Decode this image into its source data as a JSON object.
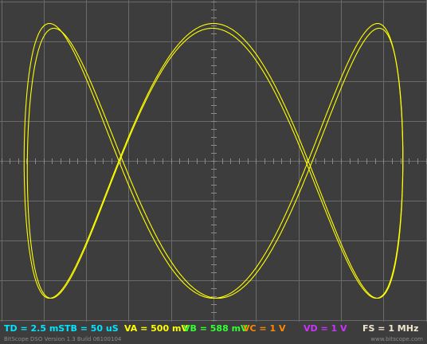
{
  "scope": {
    "background_color": "#3d3d3d",
    "grid_color": "#6a6a6a",
    "trace_color": "#ffff00",
    "grid": true,
    "divisions": {
      "horizontal": 10,
      "vertical": 8
    },
    "display_mode": "X-Y"
  },
  "chart_data": {
    "type": "line",
    "mode": "xy-lissajous",
    "title": "",
    "xlabel": "",
    "ylabel": "",
    "xlim": [
      -5,
      5
    ],
    "ylim": [
      -4,
      4
    ],
    "grid": true,
    "series": [
      {
        "color": "#ffff00",
        "frequency_ratio": "1:3",
        "x_amplitude_div": 4.46,
        "y_amplitude_div": 3.45
      }
    ]
  },
  "status": {
    "td": {
      "text": "TD = 2.5 mS",
      "color": "#00e5ff"
    },
    "tb": {
      "text": "TB = 50 uS",
      "color": "#00e5ff"
    },
    "va": {
      "text": "VA = 500 mV",
      "color": "#ffff00"
    },
    "vb": {
      "text": "VB = 588 mV",
      "color": "#33ff33"
    },
    "vc": {
      "text": "VC = 1 V",
      "color": "#ff8800"
    },
    "vd": {
      "text": "VD = 1 V",
      "color": "#cc33ff"
    },
    "fs": {
      "text": "FS = 1 MHz",
      "color": "#f0e6d0"
    }
  },
  "footer": {
    "version": "BitScope DSO Version 1.3 Build 06100104",
    "website": "www.bitscope.com"
  }
}
